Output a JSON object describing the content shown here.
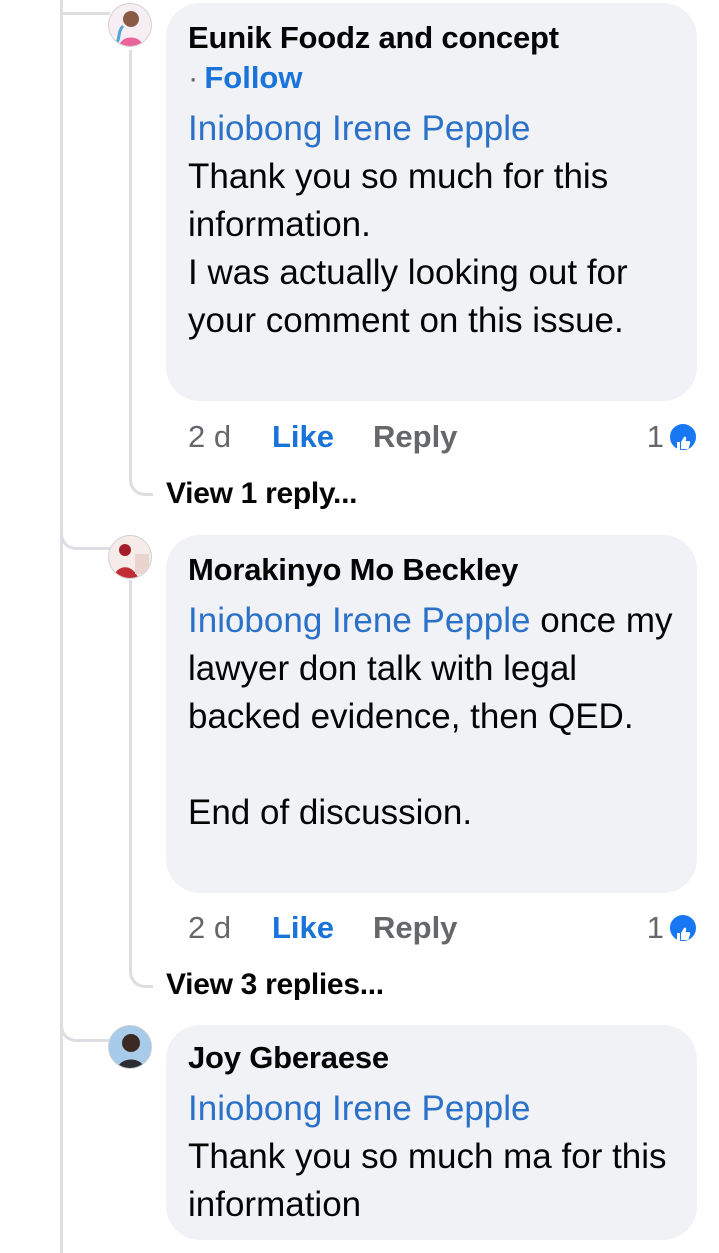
{
  "comments": [
    {
      "author": "Eunik Foodz  and concept",
      "follow_dot": "·",
      "follow_label": "Follow",
      "mention": "Iniobong Irene Pepple",
      "body_lines": [
        "Thank you so much for this information.",
        "I was actually looking out for your comment on this issue."
      ],
      "time": "2 d",
      "like_label": "Like",
      "reply_label": "Reply",
      "reaction_count": "1",
      "reaction_icon": "like-icon",
      "view_replies": "View 1 reply..."
    },
    {
      "author": "Morakinyo Mo Beckley",
      "mention": "Iniobong Irene Pepple",
      "body_inline": " once my lawyer don talk with legal backed evidence, then QED.",
      "body_after": "End of discussion.",
      "time": "2 d",
      "like_label": "Like",
      "reply_label": "Reply",
      "reaction_count": "1",
      "reaction_icon": "like-icon",
      "view_replies": "View 3 replies..."
    },
    {
      "author": "Joy Gberaese",
      "mention": "Iniobong Irene Pepple",
      "body_lines": [
        "Thank you so much ma for this information"
      ]
    }
  ],
  "colors": {
    "link_blue": "#1a73d8",
    "mention_blue": "#2a71c7",
    "bubble_bg": "#f0f2f5",
    "meta_gray": "#65676b",
    "thread_line": "#dcdee3"
  }
}
